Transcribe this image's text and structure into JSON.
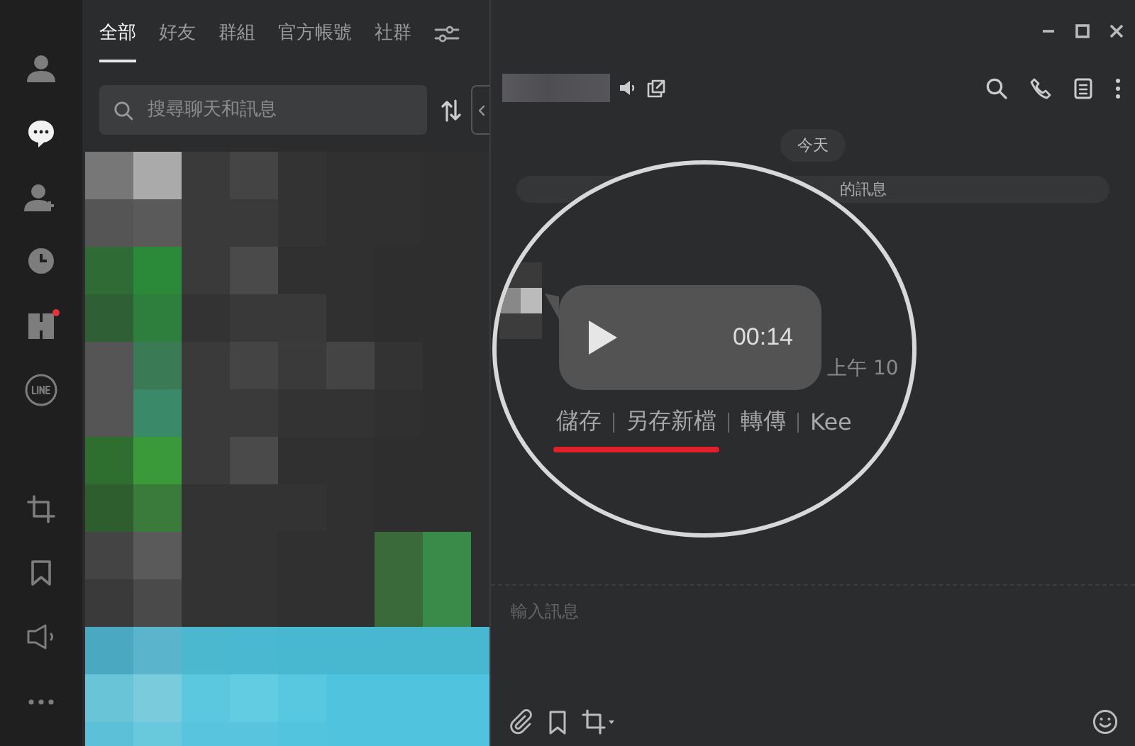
{
  "sidebar": {
    "items": [
      {
        "selected": false,
        "badge": false
      },
      {
        "selected": true,
        "badge": false
      },
      {
        "selected": false,
        "badge": false
      },
      {
        "selected": false,
        "badge": false
      },
      {
        "selected": false,
        "badge": true
      },
      {
        "selected": false,
        "badge": false
      },
      {
        "selected": false,
        "badge": false
      },
      {
        "selected": false,
        "badge": false
      },
      {
        "selected": false,
        "badge": false
      },
      {
        "selected": false,
        "badge": false
      }
    ]
  },
  "tabs": [
    {
      "label": "全部",
      "selected": true
    },
    {
      "label": "好友",
      "selected": false
    },
    {
      "label": "群組",
      "selected": false
    },
    {
      "label": "官方帳號",
      "selected": false
    },
    {
      "label": "社群",
      "selected": false
    }
  ],
  "search": {
    "placeholder": "搜尋聊天和訊息"
  },
  "chat": {
    "date": "今天",
    "notice": "的訊息",
    "voice": {
      "duration": "00:14",
      "time": "上午 10"
    },
    "actions": [
      {
        "label": "儲存",
        "highlighted": true
      },
      {
        "label": "另存新檔",
        "highlighted": true
      },
      {
        "label": "轉傳",
        "highlighted": false
      },
      {
        "label": "Kee",
        "highlighted": false
      }
    ]
  },
  "composer": {
    "placeholder": "輸入訊息"
  }
}
